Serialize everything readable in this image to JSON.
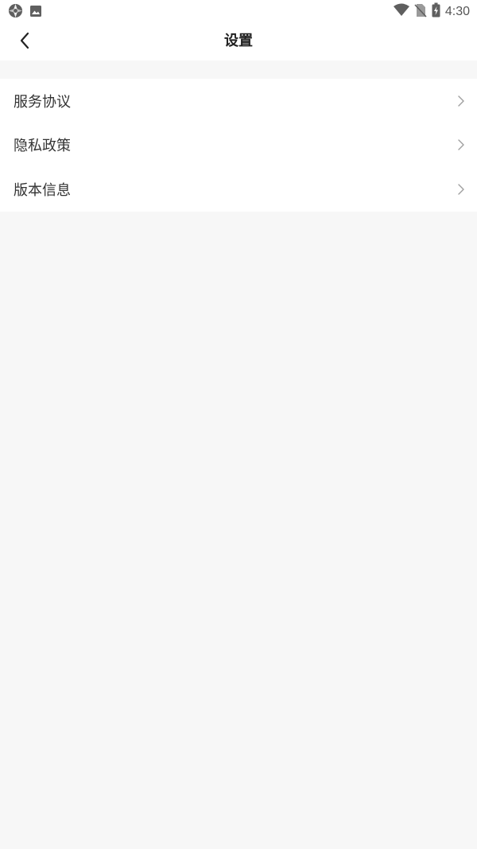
{
  "status_bar": {
    "time": "4:30",
    "left_icons": [
      "globe-app-icon",
      "image-notification-icon"
    ],
    "right_icons": [
      "wifi-icon",
      "no-sim-icon",
      "battery-charging-icon"
    ]
  },
  "header": {
    "title": "设置",
    "back_icon": "chevron-left-icon"
  },
  "menu": {
    "items": [
      {
        "label": "服务协议",
        "icon": "chevron-right-icon"
      },
      {
        "label": "隐私政策",
        "icon": "chevron-right-icon"
      },
      {
        "label": "版本信息",
        "icon": "chevron-right-icon"
      }
    ]
  },
  "colors": {
    "page_background": "#f7f7f7",
    "surface": "#ffffff",
    "text_primary": "#333333",
    "chevron": "#9e9e9e"
  }
}
